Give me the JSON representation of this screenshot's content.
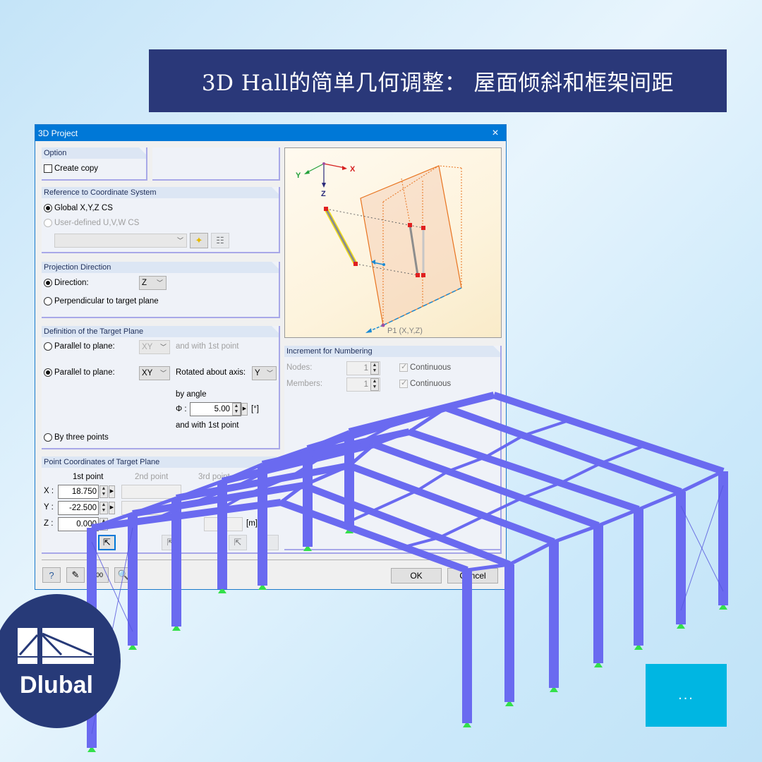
{
  "banner": {
    "title": "3D Hall的简单几何调整： 屋面倾斜和框架间距"
  },
  "dialog": {
    "title": "3D Project",
    "option": {
      "heading": "Option",
      "create_copy_label": "Create copy",
      "create_copy_checked": false
    },
    "coord_system": {
      "heading": "Reference to Coordinate System",
      "global_label": "Global X,Y,Z CS",
      "user_label": "User-defined U,V,W CS",
      "selected": "global",
      "user_cs_value": ""
    },
    "projection": {
      "heading": "Projection Direction",
      "direction_label": "Direction:",
      "direction_value": "Z",
      "perpendicular_label": "Perpendicular to target plane",
      "selected": "direction"
    },
    "target_plane": {
      "heading": "Definition of the Target Plane",
      "parallel1_label": "Parallel to plane:",
      "parallel1_value": "XY",
      "parallel1_suffix": "and with 1st point",
      "parallel2_label": "Parallel to plane:",
      "parallel2_value": "XY",
      "rotated_label": "Rotated about axis:",
      "rotated_axis": "Y",
      "by_angle_label": "by angle",
      "phi_label": "Φ :",
      "phi_value": "5.00",
      "phi_unit": "[°]",
      "and_first_point": "and with 1st point",
      "three_points_label": "By three points",
      "selected": "parallel_rotated"
    },
    "point_coords": {
      "heading": "Point Coordinates of Target Plane",
      "col_headers": [
        "1st point",
        "2nd point",
        "3rd point"
      ],
      "rows": [
        {
          "label": "X :",
          "first": "18.750",
          "second": "",
          "third": ""
        },
        {
          "label": "Y :",
          "first": "-22.500",
          "second": "",
          "third": ""
        },
        {
          "label": "Z :",
          "first": "0.000",
          "second": "",
          "third": ""
        }
      ],
      "unit": "[m]"
    },
    "numbering": {
      "heading": "Increment for Numbering",
      "nodes_label": "Nodes:",
      "nodes_value": "1",
      "members_label": "Members:",
      "members_value": "1",
      "continuous_label": "Continuous",
      "nodes_continuous": true,
      "members_continuous": true
    },
    "preview": {
      "axis_x": "X",
      "axis_y": "Y",
      "axis_z": "Z",
      "point_label": "P1 (X,Y,Z)"
    },
    "buttons": {
      "ok": "OK",
      "cancel": "Cancel"
    },
    "close_icon": "×"
  },
  "logo": {
    "text": "Dlubal"
  },
  "more_button": {
    "label": "..."
  },
  "colors": {
    "banner_bg": "#2a3879",
    "titlebar": "#0078d7",
    "member": "#6a6af0",
    "support": "#33e04a",
    "more_btn": "#00b6e2",
    "logo_bg": "#273a78"
  }
}
